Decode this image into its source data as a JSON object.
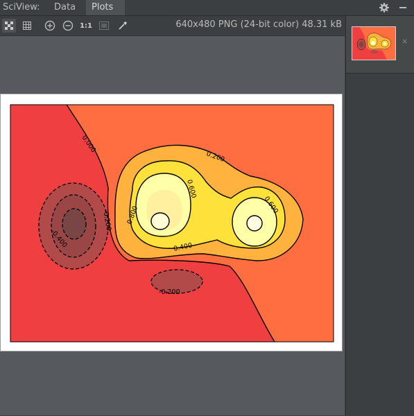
{
  "tabbar": {
    "label": "SciView:",
    "tabs": [
      {
        "label": "Data"
      },
      {
        "label": "Plots"
      }
    ],
    "icons": [
      "gear-icon",
      "minimize-icon"
    ]
  },
  "toolbar": {
    "buttons": [
      "checkerboard-icon",
      "grid-icon",
      "zoom-in-icon",
      "zoom-out-icon",
      "actual-size-button",
      "fit-window-icon",
      "color-picker-icon"
    ],
    "actual_size_label": "1:1",
    "image_info": "640x480 PNG (24-bit color) 48.31 kB"
  },
  "plot": {
    "contour_labels": [
      {
        "text": "0.000"
      },
      {
        "text": "-0.200"
      },
      {
        "text": "-0.400"
      },
      {
        "text": "0.200"
      },
      {
        "text": "0.600"
      },
      {
        "text": "0.800"
      },
      {
        "text": "0.400"
      },
      {
        "text": "0.600"
      },
      {
        "text": "-0.200"
      }
    ],
    "colors": {
      "low_dark": "#7a4545",
      "low": "#b34a4a",
      "neg": "#ef3f40",
      "base": "#ff6e40",
      "mid": "#ffb23e",
      "high": "#ffe13c",
      "top": "#ffffa8",
      "peak": "#fffdd8"
    }
  },
  "right_panel": {
    "thumbnail_close": "×"
  }
}
